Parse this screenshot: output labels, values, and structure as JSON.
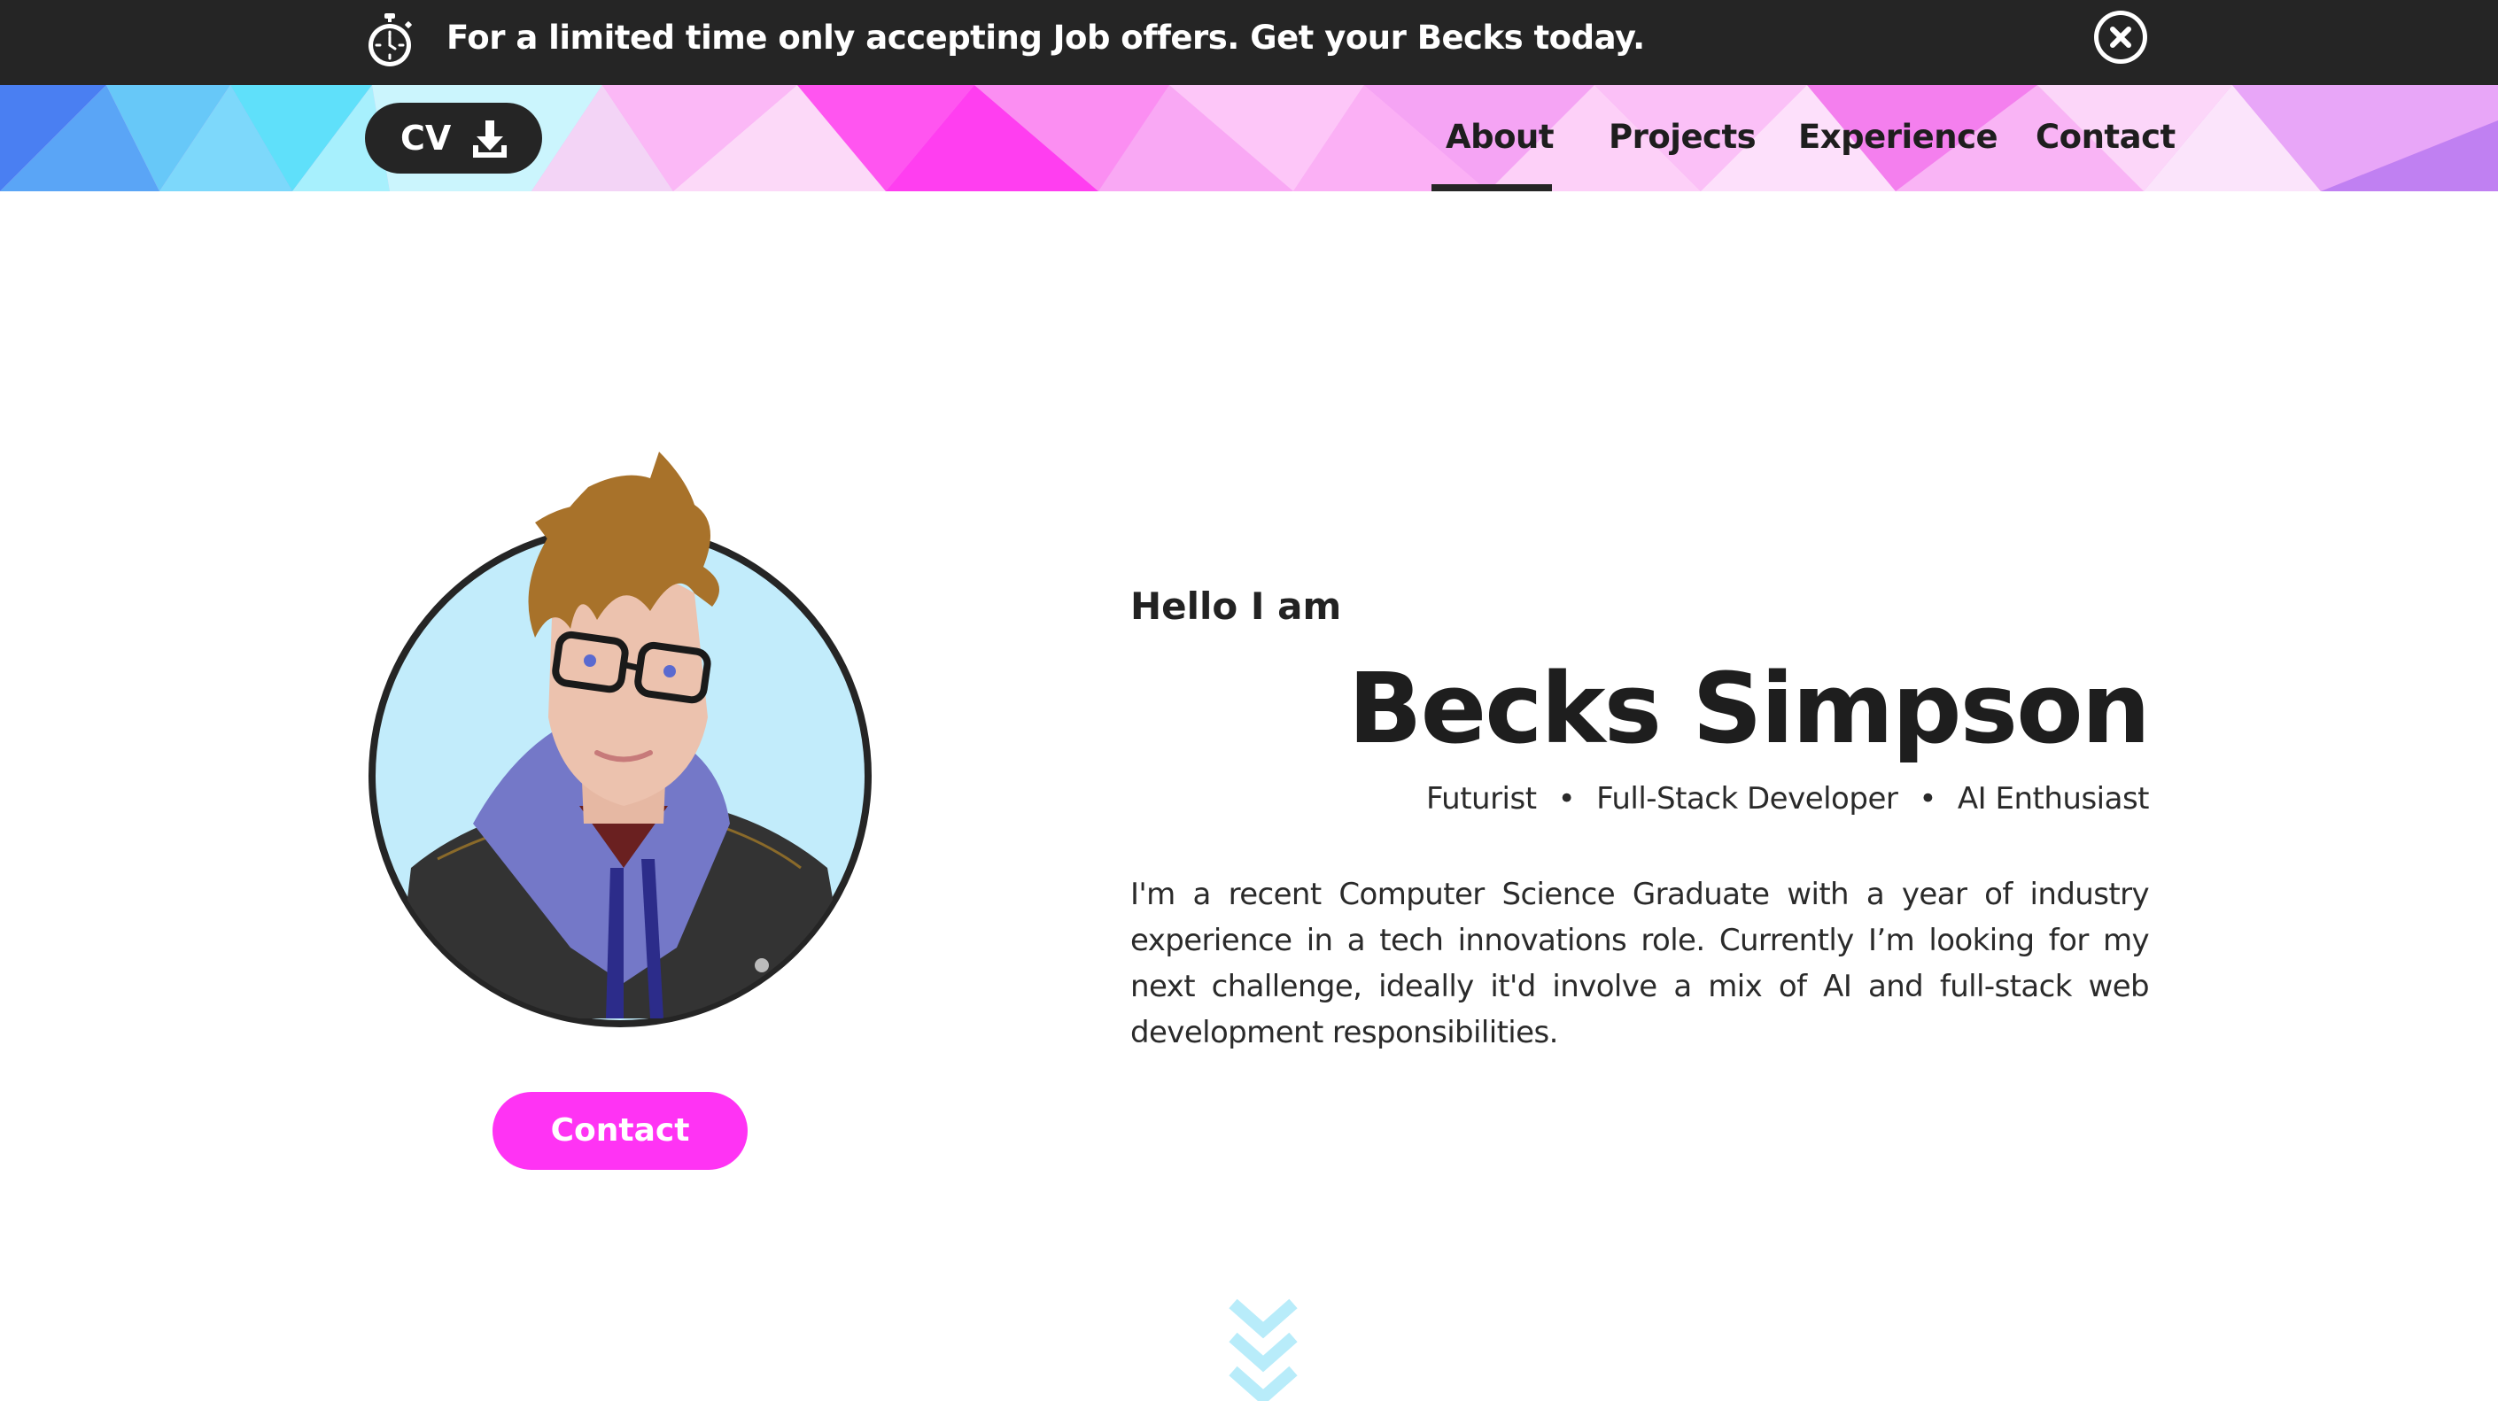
{
  "banner": {
    "icon": "stopwatch-icon",
    "message": "For a limited time only accepting Job offers. Get your Becks today.",
    "close_icon": "close-circle-icon"
  },
  "header": {
    "cv_label": "CV",
    "cv_icon": "download-icon",
    "nav": [
      {
        "label": "About",
        "active": true
      },
      {
        "label": "Projects",
        "active": false
      },
      {
        "label": "Experience",
        "active": false
      },
      {
        "label": "Contact",
        "active": false
      }
    ]
  },
  "hero": {
    "greeting": "Hello I am",
    "name": "Becks Simpson",
    "roles": [
      "Futurist",
      "Full-Stack Developer",
      "AI Enthusiast"
    ],
    "bio": "I'm a recent Computer Science Graduate with a year of industry experience in a tech innovations role. Currently I’m looking for my next challenge, ideally it'd involve a mix of AI and full-stack web development responsibilities.",
    "contact_label": "Contact",
    "scroll_icon": "chevrons-down-icon"
  },
  "colors": {
    "dark": "#252525",
    "accent_pink": "#ff33f4",
    "avatar_bg": "#c2ecfb",
    "chevron": "#b8ecfa"
  }
}
